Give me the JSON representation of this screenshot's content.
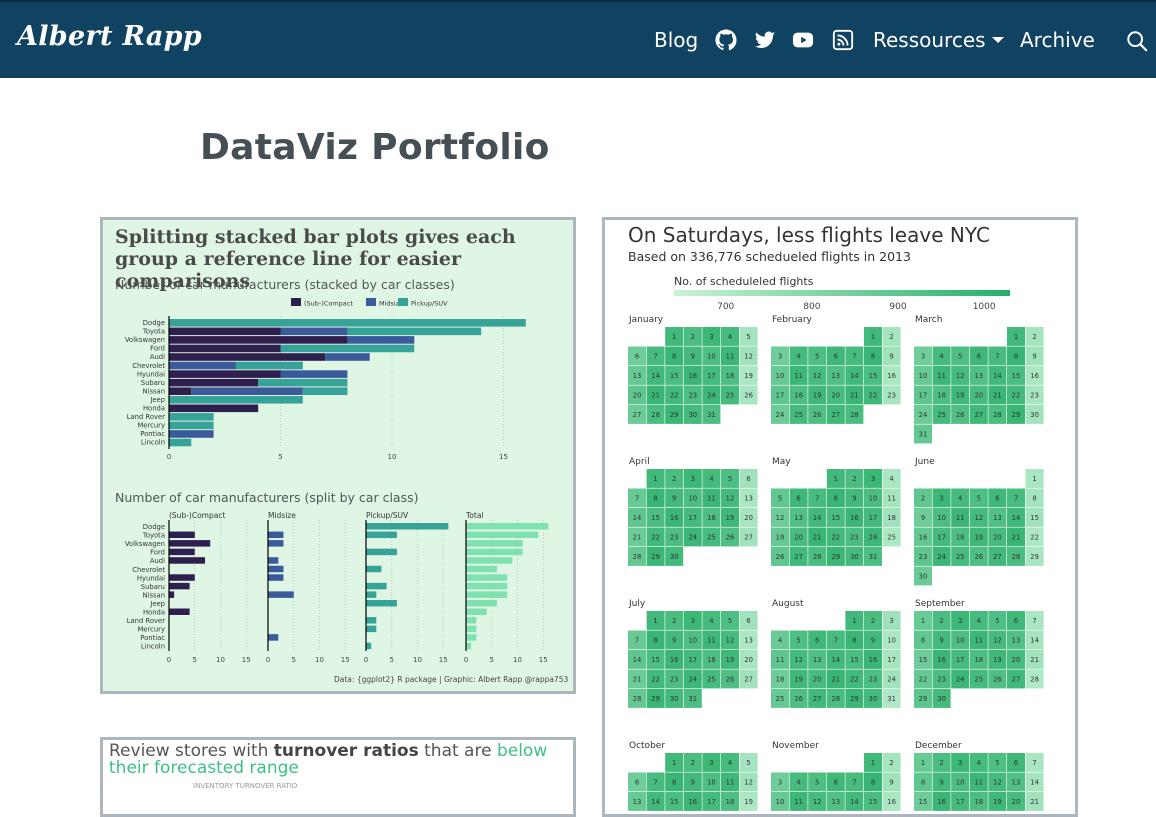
{
  "navbar": {
    "brand": "Albert Rapp",
    "blog_label": "Blog",
    "github_icon": "github-icon",
    "twitter_icon": "twitter-icon",
    "youtube_icon": "youtube-icon",
    "rss_icon": "rss-icon",
    "resources_label": "Ressources",
    "archive_label": "Archive",
    "search_icon": "search-icon",
    "background_color": "#104261"
  },
  "page": {
    "title": "DataViz Portfolio"
  },
  "cards": {
    "split_bars": {
      "title": "Splitting stacked bar plots gives each group a reference line for easier comparisons",
      "subtitle_stacked": "Number of car manufacturers (stacked by car classes)",
      "subtitle_split": "Number of car manufacturers (split by car class)",
      "caption": "Data: {ggplot2} R package | Graphic: Albert Rapp @rappa753",
      "background_color": "#dff6e4"
    },
    "flights": {
      "title": "On Saturdays, less flights leave NYC",
      "subtitle": "Based on 336,776 schedueled flights in 2013",
      "legend_title": "No. of scheduleled flights",
      "legend_ticks": [
        "700",
        "800",
        "900",
        "1000"
      ]
    },
    "turnover": {
      "title_pre": "Review stores with ",
      "title_bold": "turnover ratios",
      "title_mid": " that are ",
      "title_highlight": "below their forecasted range",
      "subtitle": "INVENTORY TURNOVER RATIO",
      "highlight_color": "#3cc281"
    }
  },
  "chart_data": [
    {
      "type": "bar",
      "title": "Number of car manufacturers (stacked by car classes)",
      "categories": [
        "Dodge",
        "Toyota",
        "Volkswagen",
        "Ford",
        "Audi",
        "Chevrolet",
        "Hyundai",
        "Subaru",
        "Nissan",
        "Jeep",
        "Honda",
        "Land Rover",
        "Mercury",
        "Pontiac",
        "Lincoln"
      ],
      "series": [
        {
          "name": "(Sub-)Compact",
          "color": "#2e1f4e",
          "values": [
            0,
            5,
            8,
            5,
            7,
            0,
            5,
            4,
            1,
            0,
            4,
            0,
            0,
            0,
            0
          ]
        },
        {
          "name": "Midsize",
          "color": "#3a5a99",
          "values": [
            0,
            3,
            3,
            0,
            2,
            3,
            3,
            0,
            5,
            0,
            0,
            0,
            0,
            2,
            0
          ]
        },
        {
          "name": "Pickup/SUV",
          "color": "#37a298",
          "values": [
            16,
            6,
            0,
            6,
            0,
            3,
            0,
            4,
            2,
            6,
            0,
            2,
            2,
            0,
            1
          ]
        }
      ],
      "x_ticks": [
        "0",
        "5",
        "10",
        "15"
      ],
      "xlim": [
        0,
        17
      ],
      "grid": true,
      "legend_position": "top"
    },
    {
      "type": "bar",
      "title": "Number of car manufacturers (split by car class)",
      "categories": [
        "Dodge",
        "Toyota",
        "Volkswagen",
        "Ford",
        "Audi",
        "Chevrolet",
        "Hyundai",
        "Subaru",
        "Nissan",
        "Jeep",
        "Honda",
        "Land Rover",
        "Mercury",
        "Pontiac",
        "Lincoln"
      ],
      "panels": [
        {
          "name": "(Sub-)Compact",
          "color": "#2e1f4e",
          "values": [
            0,
            5,
            8,
            5,
            7,
            0,
            5,
            4,
            1,
            0,
            4,
            0,
            0,
            0,
            0
          ]
        },
        {
          "name": "Midsize",
          "color": "#3a5a99",
          "values": [
            0,
            3,
            3,
            0,
            2,
            3,
            3,
            0,
            5,
            0,
            0,
            0,
            0,
            2,
            0
          ]
        },
        {
          "name": "Pickup/SUV",
          "color": "#37a298",
          "values": [
            16,
            6,
            0,
            6,
            0,
            3,
            0,
            4,
            2,
            6,
            0,
            2,
            2,
            0,
            1
          ]
        },
        {
          "name": "Total",
          "color": "#7fe0b0",
          "values": [
            16,
            14,
            11,
            11,
            9,
            6,
            8,
            8,
            8,
            6,
            4,
            2,
            2,
            2,
            1
          ]
        }
      ],
      "x_ticks": [
        "0",
        "5",
        "10",
        "15"
      ],
      "xlim": [
        0,
        17
      ]
    },
    {
      "type": "heatmap",
      "title": "On Saturdays, less flights leave NYC",
      "legend_ticks": [
        700,
        800,
        900,
        1000
      ],
      "value_range": [
        640,
        1030
      ],
      "year": 2013,
      "months": [
        {
          "name": "January",
          "start_weekday": 2,
          "days": 31,
          "saturday_value": 720,
          "weekday_value": 960,
          "sunday_value": 880
        },
        {
          "name": "February",
          "start_weekday": 5,
          "days": 28,
          "saturday_value": 720,
          "weekday_value": 960,
          "sunday_value": 880
        },
        {
          "name": "March",
          "start_weekday": 5,
          "days": 31,
          "saturday_value": 720,
          "weekday_value": 960,
          "sunday_value": 880
        },
        {
          "name": "April",
          "start_weekday": 1,
          "days": 30,
          "saturday_value": 720,
          "weekday_value": 960,
          "sunday_value": 880
        },
        {
          "name": "May",
          "start_weekday": 3,
          "days": 31,
          "saturday_value": 720,
          "weekday_value": 960,
          "sunday_value": 880
        },
        {
          "name": "June",
          "start_weekday": 6,
          "days": 30,
          "saturday_value": 720,
          "weekday_value": 960,
          "sunday_value": 880
        },
        {
          "name": "July",
          "start_weekday": 1,
          "days": 31,
          "saturday_value": 720,
          "weekday_value": 960,
          "sunday_value": 880
        },
        {
          "name": "August",
          "start_weekday": 4,
          "days": 31,
          "saturday_value": 720,
          "weekday_value": 960,
          "sunday_value": 880
        },
        {
          "name": "September",
          "start_weekday": 0,
          "days": 30,
          "saturday_value": 720,
          "weekday_value": 960,
          "sunday_value": 880
        },
        {
          "name": "October",
          "start_weekday": 2,
          "days": 31,
          "saturday_value": 720,
          "weekday_value": 960,
          "sunday_value": 880
        },
        {
          "name": "November",
          "start_weekday": 5,
          "days": 30,
          "saturday_value": 720,
          "weekday_value": 960,
          "sunday_value": 880
        },
        {
          "name": "December",
          "start_weekday": 0,
          "days": 31,
          "saturday_value": 720,
          "weekday_value": 960,
          "sunday_value": 880
        }
      ],
      "color_low": "#b8f0cd",
      "color_high": "#27ae68"
    }
  ]
}
